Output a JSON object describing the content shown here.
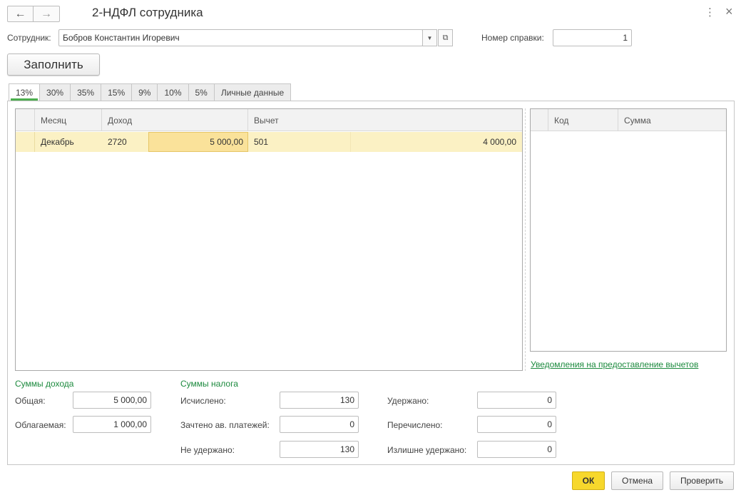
{
  "window": {
    "title": "2-НДФЛ сотрудника",
    "back_icon": "←",
    "forward_icon": "→",
    "menu_icon": "⋮",
    "close_icon": "×"
  },
  "employee": {
    "label": "Сотрудник:",
    "value": "Бобров Константин Игоревич",
    "dropdown_icon": "▼",
    "open_icon": "⧉"
  },
  "certificate": {
    "label": "Номер справки:",
    "value": "1"
  },
  "fill_button": "Заполнить",
  "tabs": [
    "13%",
    "30%",
    "35%",
    "15%",
    "9%",
    "10%",
    "5%",
    "Личные данные"
  ],
  "income_table": {
    "headers": {
      "month": "Месяц",
      "income": "Доход",
      "deduction": "Вычет"
    },
    "rows": [
      {
        "month": "Декабрь",
        "income_code": "2720",
        "income_sum": "5 000,00",
        "deduction_code": "501",
        "deduction_sum": "4 000,00"
      }
    ]
  },
  "code_table": {
    "headers": {
      "code": "Код",
      "sum": "Сумма"
    }
  },
  "notifications_link": "Уведомления на предоставление вычетов",
  "income_sums": {
    "title": "Суммы дохода",
    "total_label": "Общая:",
    "total_value": "5 000,00",
    "taxable_label": "Облагаемая:",
    "taxable_value": "1 000,00"
  },
  "tax_sums": {
    "title": "Суммы налога",
    "calculated_label": "Исчислено:",
    "calculated_value": "130",
    "advance_label": "Зачтено ав. платежей:",
    "advance_value": "0",
    "not_withheld_label": "Не удержано:",
    "not_withheld_value": "130",
    "withheld_label": "Удержано:",
    "withheld_value": "0",
    "transferred_label": "Перечислено:",
    "transferred_value": "0",
    "overwithheld_label": "Излишне удержано:",
    "overwithheld_value": "0"
  },
  "buttons": {
    "ok": "ОК",
    "cancel": "Отмена",
    "check": "Проверить"
  },
  "colors": {
    "accent_green": "#1c8a3e",
    "ok_yellow": "#f7d82c",
    "row_highlight": "#fbf1c4"
  }
}
